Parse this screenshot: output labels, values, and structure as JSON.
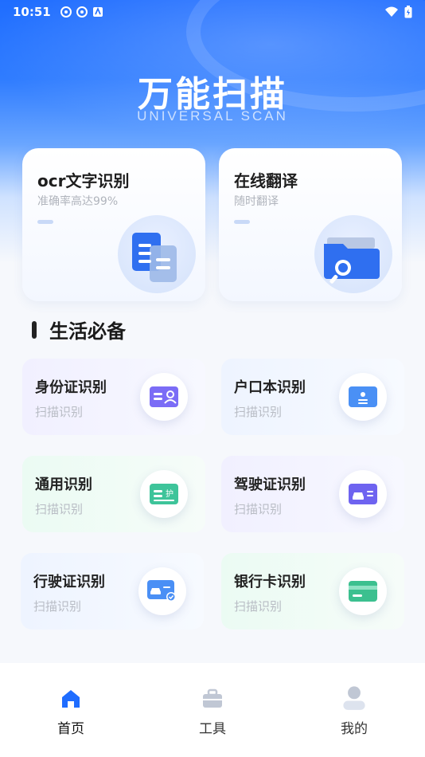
{
  "status_bar": {
    "time": "10:51"
  },
  "hero": {
    "title": "万能扫描",
    "subtitle": "UNIVERSAL SCAN"
  },
  "feature_cards": [
    {
      "title": "ocr文字识别",
      "subtitle": "准确率高达99%",
      "icon": "document-stack-icon"
    },
    {
      "title": "在线翻译",
      "subtitle": "随时翻译",
      "icon": "folder-search-icon"
    }
  ],
  "section": {
    "title": "生活必备"
  },
  "tools": [
    {
      "title": "身份证识别",
      "subtitle": "扫描识别",
      "icon": "id-card-icon",
      "color": "#7b6cf6"
    },
    {
      "title": "户口本识别",
      "subtitle": "扫描识别",
      "icon": "household-register-icon",
      "color": "#4a90f5"
    },
    {
      "title": "通用识别",
      "subtitle": "扫描识别",
      "icon": "general-scan-icon",
      "color": "#3ec49a",
      "icon_text": "护"
    },
    {
      "title": "驾驶证识别",
      "subtitle": "扫描识别",
      "icon": "driver-license-icon",
      "color": "#6e63f0"
    },
    {
      "title": "行驶证识别",
      "subtitle": "扫描识别",
      "icon": "vehicle-license-icon",
      "color": "#4a8ff5"
    },
    {
      "title": "银行卡识别",
      "subtitle": "扫描识别",
      "icon": "bank-card-icon",
      "color": "#3cc08f"
    }
  ],
  "bottom_nav": [
    {
      "label": "首页",
      "icon": "home-icon",
      "active": true
    },
    {
      "label": "工具",
      "icon": "toolbox-icon",
      "active": false
    },
    {
      "label": "我的",
      "icon": "profile-icon",
      "active": false
    }
  ],
  "colors": {
    "primary": "#1f6dff",
    "active_nav": "#1f6dff",
    "inactive_nav": "#c0c7d4"
  }
}
